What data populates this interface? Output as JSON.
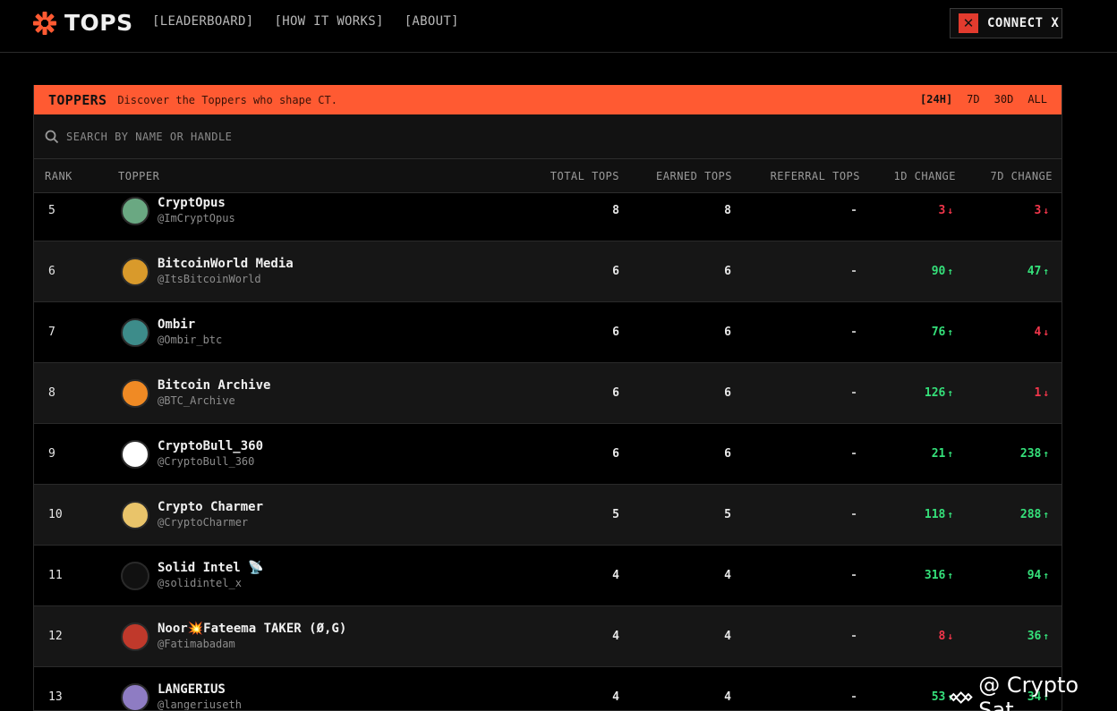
{
  "brand": {
    "name": "TOPS",
    "accent": "#ff5a32"
  },
  "nav": [
    "[LEADERBOARD]",
    "[HOW IT WORKS]",
    "[ABOUT]"
  ],
  "connect": {
    "icon": "x-logo-icon",
    "label": "CONNECT X"
  },
  "panel": {
    "title": "TOPPERS",
    "subtitle": "Discover the Toppers who shape CT.",
    "periods": [
      "[24H]",
      "7D",
      "30D",
      "ALL"
    ],
    "active_period": "[24H]"
  },
  "search": {
    "placeholder": "SEARCH BY NAME OR HANDLE"
  },
  "columns": [
    "RANK",
    "TOPPER",
    "TOTAL TOPS",
    "EARNED TOPS",
    "REFERRAL TOPS",
    "1D CHANGE",
    "7D CHANGE"
  ],
  "rows": [
    {
      "rank": "5",
      "name": "CryptOpus",
      "handle": "@ImCryptOpus",
      "total": "8",
      "earned": "8",
      "referral": "-",
      "d1": "3",
      "d1_dir": "down",
      "d7": "3",
      "d7_dir": "down",
      "avatar_color": "#6aa882"
    },
    {
      "rank": "6",
      "name": "BitcoinWorld Media",
      "handle": "@ItsBitcoinWorld",
      "total": "6",
      "earned": "6",
      "referral": "-",
      "d1": "90",
      "d1_dir": "up",
      "d7": "47",
      "d7_dir": "up",
      "avatar_color": "#d99a2b"
    },
    {
      "rank": "7",
      "name": "Ombir",
      "handle": "@Ombir_btc",
      "total": "6",
      "earned": "6",
      "referral": "-",
      "d1": "76",
      "d1_dir": "up",
      "d7": "4",
      "d7_dir": "down",
      "avatar_color": "#3d8c8a"
    },
    {
      "rank": "8",
      "name": "Bitcoin Archive",
      "handle": "@BTC_Archive",
      "total": "6",
      "earned": "6",
      "referral": "-",
      "d1": "126",
      "d1_dir": "up",
      "d7": "1",
      "d7_dir": "down",
      "avatar_color": "#f08a24"
    },
    {
      "rank": "9",
      "name": "CryptoBull_360",
      "handle": "@CryptoBull_360",
      "total": "6",
      "earned": "6",
      "referral": "-",
      "d1": "21",
      "d1_dir": "up",
      "d7": "238",
      "d7_dir": "up",
      "avatar_color": "#ffffff"
    },
    {
      "rank": "10",
      "name": "Crypto Charmer",
      "handle": "@CryptoCharmer",
      "total": "5",
      "earned": "5",
      "referral": "-",
      "d1": "118",
      "d1_dir": "up",
      "d7": "288",
      "d7_dir": "up",
      "avatar_color": "#e9c46a"
    },
    {
      "rank": "11",
      "name": "Solid Intel 📡",
      "handle": "@solidintel_x",
      "total": "4",
      "earned": "4",
      "referral": "-",
      "d1": "316",
      "d1_dir": "up",
      "d7": "94",
      "d7_dir": "up",
      "avatar_color": "#111111"
    },
    {
      "rank": "12",
      "name": "Noor💥Fateema TAKER (Ø,G)",
      "handle": "@Fatimabadam",
      "total": "4",
      "earned": "4",
      "referral": "-",
      "d1": "8",
      "d1_dir": "down",
      "d7": "36",
      "d7_dir": "up",
      "avatar_color": "#c0392b"
    },
    {
      "rank": "13",
      "name": "LANGERIUS",
      "handle": "@langeriuseth",
      "total": "4",
      "earned": "4",
      "referral": "-",
      "d1": "53",
      "d1_dir": "up",
      "d7": "34",
      "d7_dir": "up",
      "avatar_color": "#8e7cc3"
    }
  ],
  "colors": {
    "up": "#35e07a",
    "down": "#f2364b"
  },
  "watermark": {
    "icon": "binance-logo-icon",
    "text": "@ Crypto Sat"
  }
}
